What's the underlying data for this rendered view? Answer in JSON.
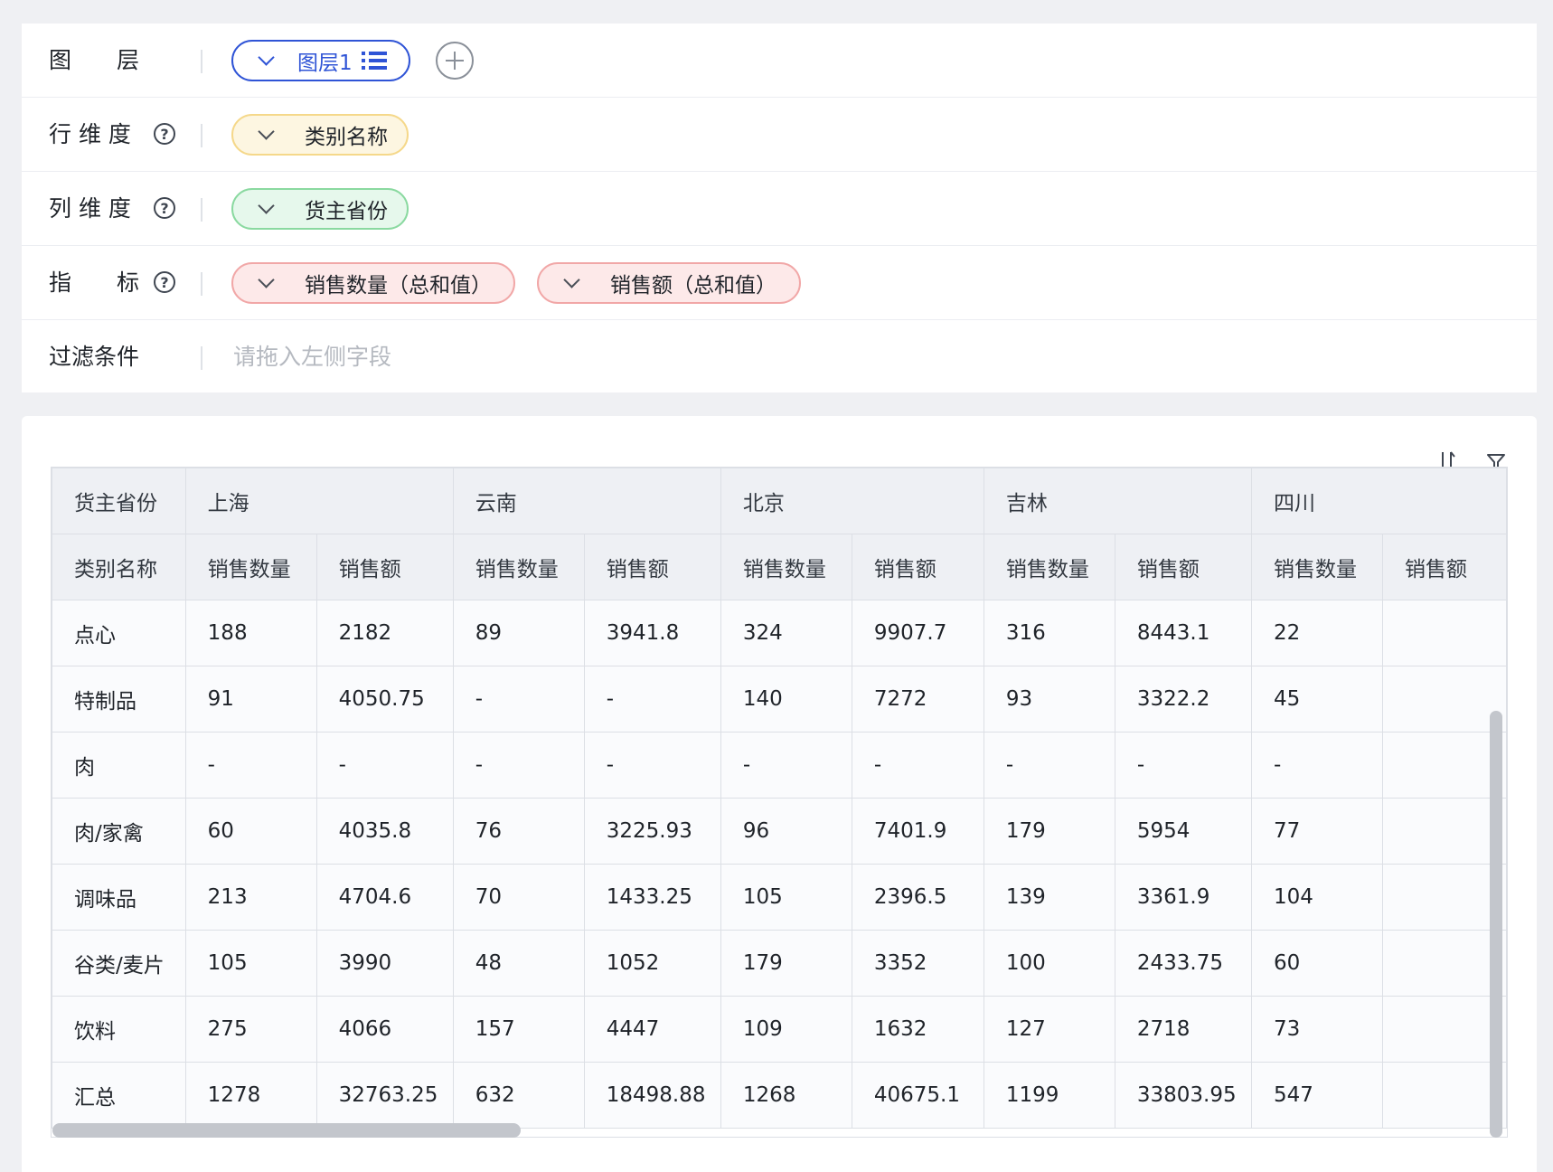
{
  "config": {
    "layer": {
      "label": "图　　层",
      "pill": "图层1"
    },
    "row_dim": {
      "label": "行 维 度",
      "pill": "类别名称"
    },
    "col_dim": {
      "label": "列 维 度",
      "pill": "货主省份"
    },
    "metrics": {
      "label": "指　　标",
      "pills": [
        "销售数量（总和值）",
        "销售额（总和值）"
      ]
    },
    "filter": {
      "label": "过滤条件",
      "placeholder": "请拖入左侧字段"
    },
    "help_glyph": "?"
  },
  "table": {
    "corner_top": "货主省份",
    "corner_bottom": "类别名称",
    "provinces": [
      "上海",
      "云南",
      "北京",
      "吉林",
      "四川"
    ],
    "measures": [
      "销售数量",
      "销售额"
    ],
    "rows": [
      {
        "name": "点心",
        "values": [
          "188",
          "2182",
          "89",
          "3941.8",
          "324",
          "9907.7",
          "316",
          "8443.1",
          "22"
        ]
      },
      {
        "name": "特制品",
        "values": [
          "91",
          "4050.75",
          "-",
          "-",
          "140",
          "7272",
          "93",
          "3322.2",
          "45"
        ]
      },
      {
        "name": "肉",
        "values": [
          "-",
          "-",
          "-",
          "-",
          "-",
          "-",
          "-",
          "-",
          "-"
        ]
      },
      {
        "name": "肉/家禽",
        "values": [
          "60",
          "4035.8",
          "76",
          "3225.93",
          "96",
          "7401.9",
          "179",
          "5954",
          "77"
        ]
      },
      {
        "name": "调味品",
        "values": [
          "213",
          "4704.6",
          "70",
          "1433.25",
          "105",
          "2396.5",
          "139",
          "3361.9",
          "104"
        ]
      },
      {
        "name": "谷类/麦片",
        "values": [
          "105",
          "3990",
          "48",
          "1052",
          "179",
          "3352",
          "100",
          "2433.75",
          "60"
        ]
      },
      {
        "name": "饮料",
        "values": [
          "275",
          "4066",
          "157",
          "4447",
          "109",
          "1632",
          "127",
          "2718",
          "73"
        ]
      },
      {
        "name": "汇总",
        "values": [
          "1278",
          "32763.25",
          "632",
          "18498.88",
          "1268",
          "40675.1",
          "1199",
          "33803.95",
          "547"
        ]
      }
    ]
  }
}
